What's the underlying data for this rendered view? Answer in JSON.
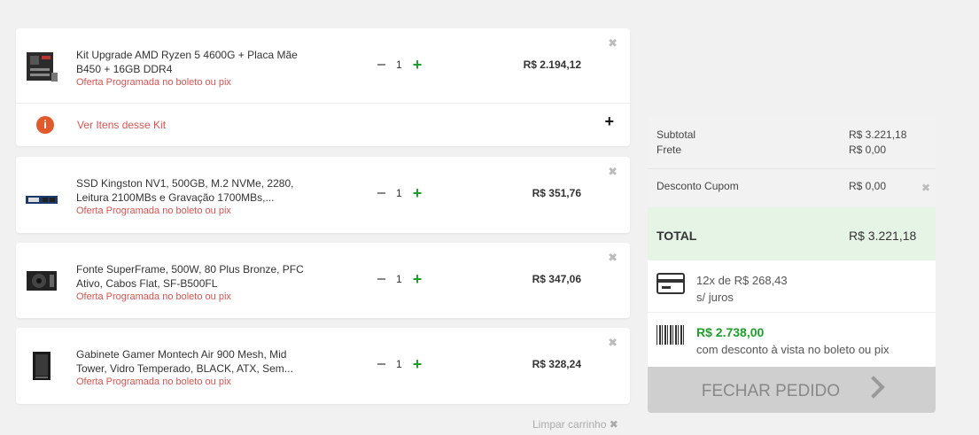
{
  "items": [
    {
      "name": "Kit Upgrade AMD Ryzen 5 4600G + Placa Mãe B450 + 16GB DDR4",
      "offer": "Oferta Programada no boleto ou pix",
      "qty": "1",
      "price": "R$ 2.194,12",
      "icon": "motherboard-icon"
    },
    {
      "name": "SSD Kingston NV1, 500GB, M.2 NVMe, 2280, Leitura 2100MBs e Gravação 1700MBs,...",
      "offer": "Oferta Programada no boleto ou pix",
      "qty": "1",
      "price": "R$ 351,76",
      "icon": "ssd-icon"
    },
    {
      "name": "Fonte SuperFrame, 500W, 80 Plus Bronze, PFC Ativo, Cabos Flat, SF-B500FL",
      "offer": "Oferta Programada no boleto ou pix",
      "qty": "1",
      "price": "R$ 347,06",
      "icon": "power-supply-icon"
    },
    {
      "name": "Gabinete Gamer Montech Air 900 Mesh, Mid Tower, Vidro Temperado, BLACK, ATX, Sem...",
      "offer": "Oferta Programada no boleto ou pix",
      "qty": "1",
      "price": "R$ 328,24",
      "icon": "pc-case-icon"
    }
  ],
  "kit": {
    "link_label": "Ver Itens desse Kit",
    "info_glyph": "i",
    "expand_glyph": "+"
  },
  "cart": {
    "clear_label": "Limpar carrinho",
    "clear_glyph": "✖",
    "remove_glyph": "✖"
  },
  "summary": {
    "subtotal_label": "Subtotal",
    "subtotal_value": "R$ 3.221,18",
    "frete_label": "Frete",
    "frete_value": "R$ 0,00",
    "coupon_label": "Desconto Cupom",
    "coupon_value": "R$ 0,00",
    "total_label": "TOTAL",
    "total_value": "R$ 3.221,18",
    "installments_line1": "12x de R$ 268,43",
    "installments_line2": "s/ juros",
    "pix_price": "R$ 2.738,00",
    "pix_note": "com desconto à vista no boleto ou pix",
    "checkout_label": "FECHAR PEDIDO"
  },
  "colors": {
    "accent_green": "#1e9e2b",
    "offer_red": "#d9534f",
    "info_orange": "#e05a2b",
    "total_bg": "#e6f4e6"
  }
}
